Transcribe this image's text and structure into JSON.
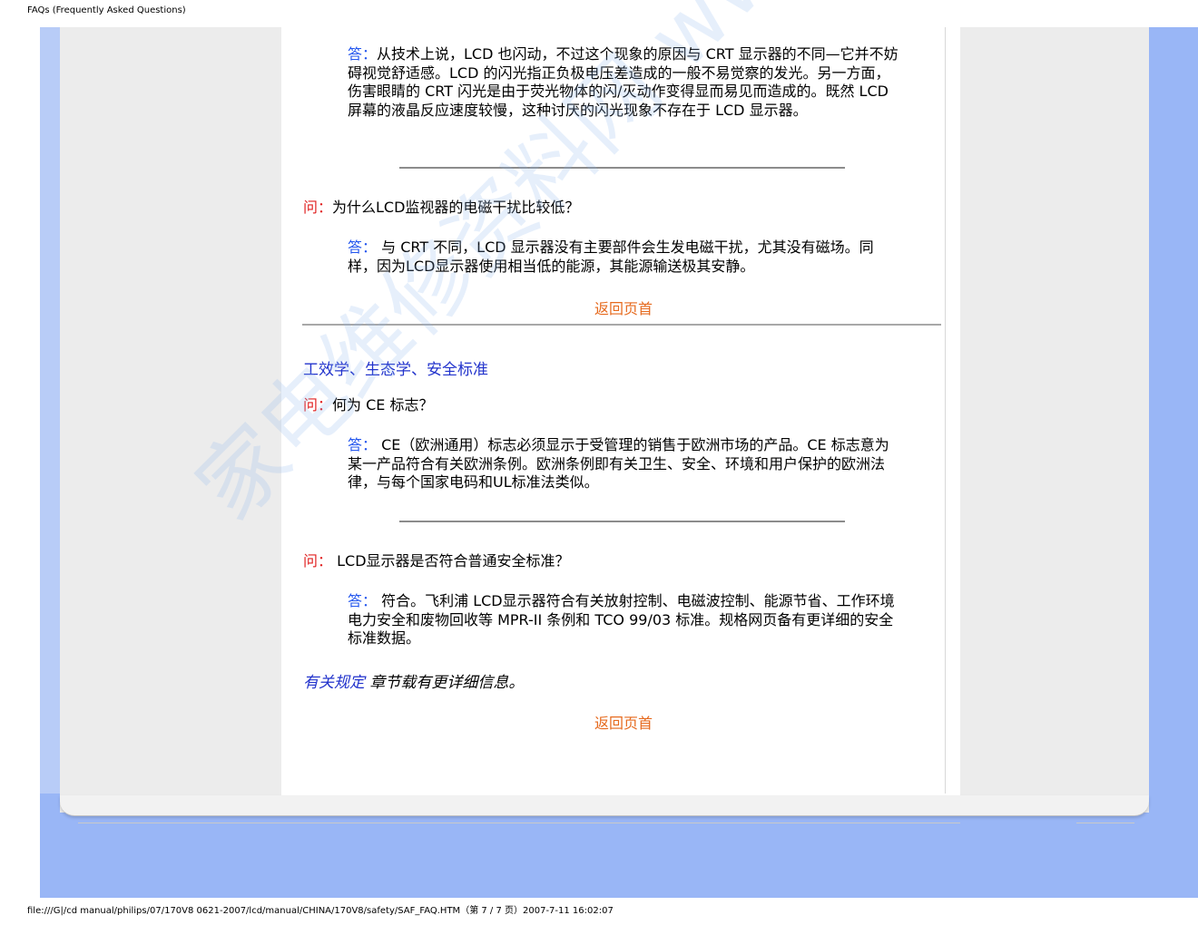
{
  "header": {
    "title": "FAQs (Frequently Asked Questions)"
  },
  "footer": {
    "text": "file:///G|/cd manual/philips/07/170V8 0621-2007/lcd/manual/CHINA/170V8/safety/SAF_FAQ.HTM（第 7 / 7 页）2007-7-11 16:02:07"
  },
  "watermark": "家电维修资料网 www.520101.com",
  "colors": {
    "frame": "#99b6f6",
    "question_label": "#e02020",
    "answer_label": "#2255ee",
    "link": "#2233cc",
    "back_link": "#e66a1e"
  },
  "content": {
    "answer_flicker": {
      "label": "答：",
      "text": "从技术上说，LCD 也闪动，不过这个现象的原因与 CRT 显示器的不同—它并不妨碍视觉舒适感。LCD 的闪光指正负极电压差造成的一般不易觉察的发光。另一方面，伤害眼睛的 CRT 闪光是由于荧光物体的闪/灭动作变得显而易见而造成的。既然 LCD 屏幕的液晶反应速度较慢，这种讨厌的闪光现象不存在于 LCD 显示器。"
    },
    "q_emi": {
      "label": "问：",
      "text": "为什么LCD监视器的电磁干扰比较低？"
    },
    "a_emi": {
      "label": "答：",
      "text": " 与 CRT 不同，LCD 显示器没有主要部件会生发电磁干扰，尤其没有磁场。同样，因为LCD显示器使用相当低的能源，其能源输送极其安静。"
    },
    "back_to_top_1": "返回页首",
    "section_title": "工效学、生态学、安全标准",
    "q_ce": {
      "label": "问：",
      "text": "何为 CE 标志？"
    },
    "a_ce": {
      "label": "答：",
      "text": " CE（欧洲通用）标志必须显示于受管理的销售于欧洲市场的产品。CE 标志意为某一产品符合有关欧洲条例。欧洲条例即有关卫生、安全、环境和用户保护的欧洲法律，与每个国家电码和UL标准法类似。"
    },
    "q_safety": {
      "label": "问：",
      "text": " LCD显示器是否符合普通安全标准？"
    },
    "a_safety": {
      "label": "答：",
      "text": " 符合。飞利浦 LCD显示器符合有关放射控制、电磁波控制、能源节省、工作环境电力安全和废物回收等 MPR-II 条例和 TCO 99/03 标准。规格网页备有更详细的安全标准数据。"
    },
    "reg_note": {
      "link": "有关规定",
      "text": " 章节载有更详细信息。"
    },
    "back_to_top_2": "返回页首"
  }
}
